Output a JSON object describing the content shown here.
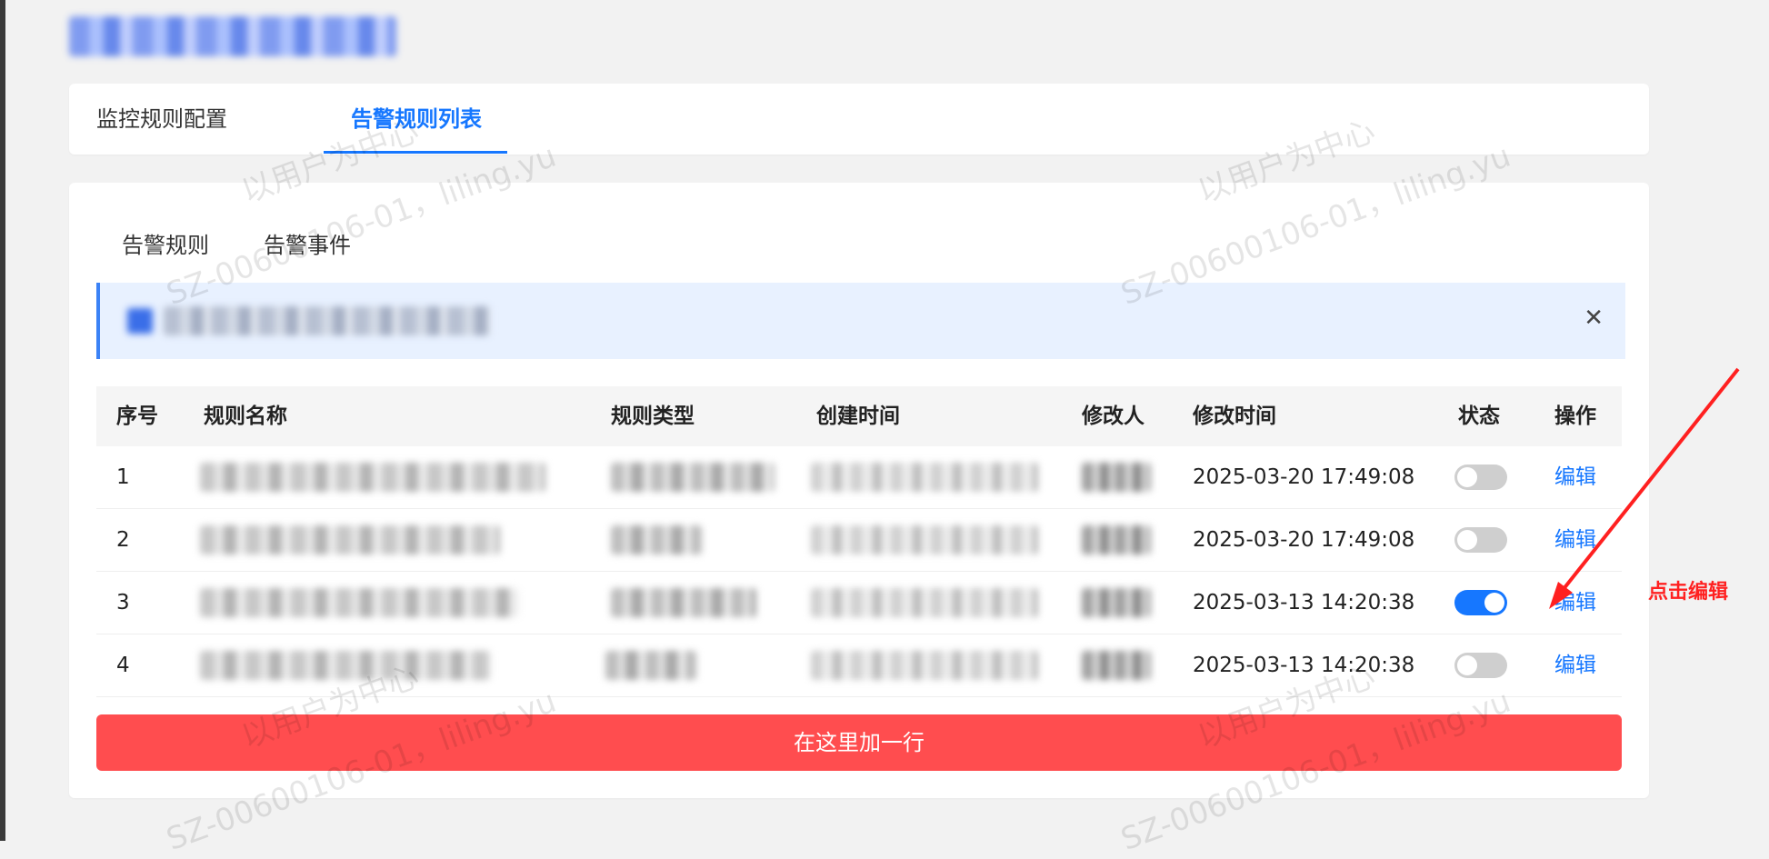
{
  "page": {
    "header_title": "",
    "tabs": [
      {
        "label": "监控规则配置",
        "active": false
      },
      {
        "label": "告警规则列表",
        "active": true
      }
    ],
    "subtabs": [
      {
        "label": "告警规则"
      },
      {
        "label": "告警事件"
      }
    ],
    "alert": {
      "text": "",
      "close_icon": "close-icon"
    },
    "table": {
      "columns": [
        "序号",
        "规则名称",
        "规则类型",
        "创建时间",
        "修改人",
        "修改时间",
        "状态",
        "操作"
      ],
      "rows": [
        {
          "index": "1",
          "modify_time": "2025-03-20 17:49:08",
          "status_on": false,
          "action": "编辑"
        },
        {
          "index": "2",
          "modify_time": "2025-03-20 17:49:08",
          "status_on": false,
          "action": "编辑"
        },
        {
          "index": "3",
          "modify_time": "2025-03-13 14:20:38",
          "status_on": true,
          "action": "编辑"
        },
        {
          "index": "4",
          "modify_time": "2025-03-13 14:20:38",
          "status_on": false,
          "action": "编辑"
        }
      ]
    },
    "add_row_button": "在这里加一行",
    "annotation": {
      "text": "点击编辑",
      "color": "#ff2020"
    },
    "colors": {
      "primary": "#1677ff",
      "danger": "#ff4d4f",
      "alert_bg": "#e8f1ff",
      "page_bg": "#f2f2f2"
    },
    "watermark": {
      "line1": "以用户为中心",
      "line2": "SZ-00600106-01，liling.yu"
    }
  }
}
